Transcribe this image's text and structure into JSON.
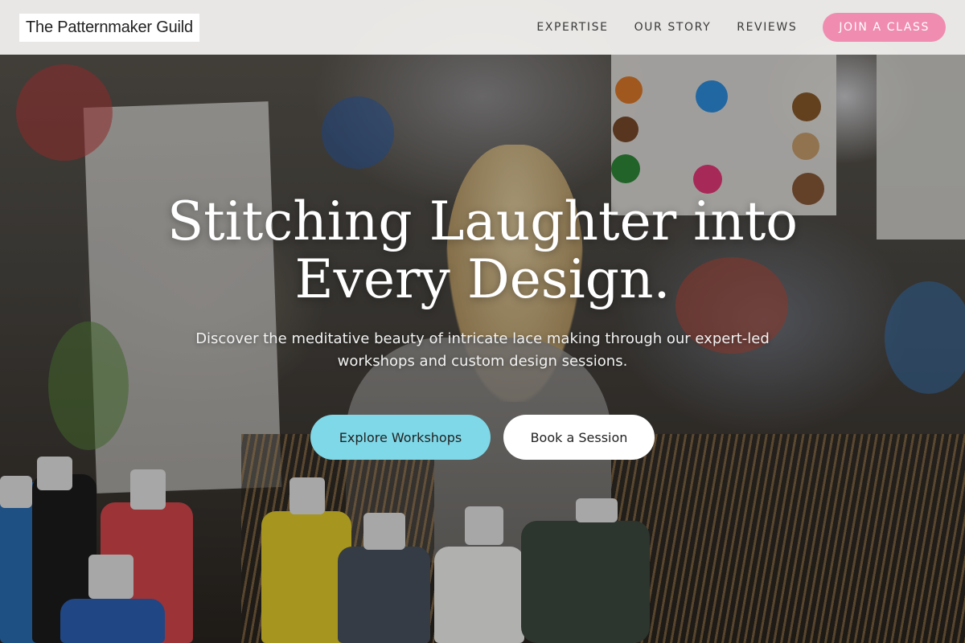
{
  "header": {
    "brand": "The Patternmaker Guild",
    "nav": [
      {
        "label": "EXPERTISE"
      },
      {
        "label": "OUR STORY"
      },
      {
        "label": "REVIEWS"
      }
    ],
    "cta_label": "JOIN A CLASS"
  },
  "hero": {
    "headline": "Stitching Laughter into Every Design.",
    "subhead": "Discover the meditative beauty of intricate lace making through our expert-led workshops and custom design sessions.",
    "primary_button": "Explore Workshops",
    "secondary_button": "Book a Session"
  },
  "colors": {
    "cta_pink": "#f08cb0",
    "primary_button": "#7fd8e8",
    "secondary_button": "#ffffff"
  }
}
